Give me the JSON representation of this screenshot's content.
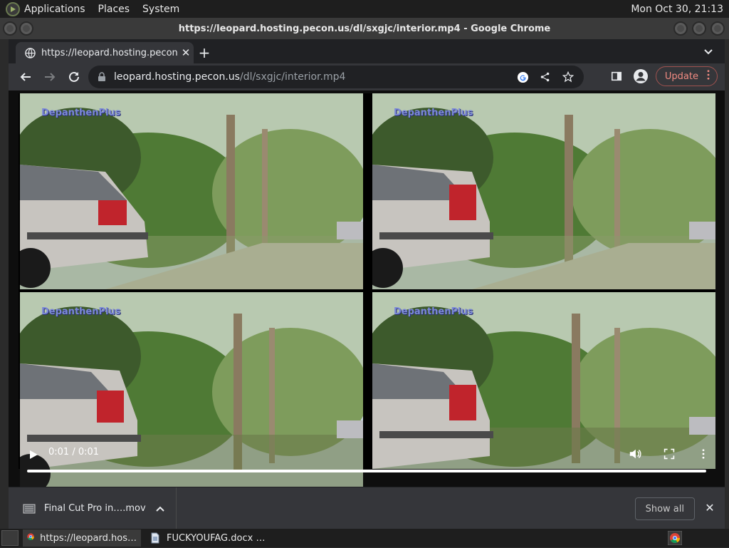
{
  "topbar": {
    "menus": [
      "Applications",
      "Places",
      "System"
    ],
    "clock": "Mon Oct 30, 21:13"
  },
  "window": {
    "title": "https://leopard.hosting.pecon.us/dl/sxgjc/interior.mp4 - Google Chrome"
  },
  "tab": {
    "title": "https://leopard.hosting.pecon.us/dl/sxgjc/interior.mp4",
    "close": "✕",
    "new_tab": "+"
  },
  "omnibox": {
    "host": "leopard.hosting.pecon.us",
    "path": "/dl/sxgjc/interior.mp4"
  },
  "toolbar": {
    "update_label": "Update"
  },
  "video": {
    "time": "0:01 / 0:01",
    "watermark": "DepanthenPlus",
    "progress": 1.0
  },
  "downloads": {
    "item_name": "Final Cut Pro in….mov",
    "show_all": "Show all",
    "close": "✕"
  },
  "taskbar": {
    "tasks": [
      "https://leopard.hos…",
      "FUCKYOUFAG.docx …"
    ]
  },
  "colors": {
    "chrome_dark": "#35363a",
    "tabstrip": "#202124",
    "update_accent": "#f28b82"
  }
}
